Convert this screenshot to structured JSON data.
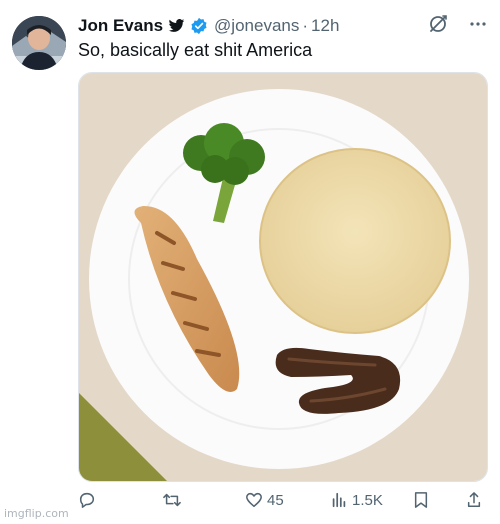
{
  "tweet": {
    "author_name": "Jon Evans",
    "handle": "@jonevans",
    "separator": "·",
    "time": "12h",
    "text": "So, basically eat shit America"
  },
  "icons": {
    "platform": "bird-icon",
    "verified": "verified-badge-icon",
    "grok": "grok-icon",
    "more": "more-icon"
  },
  "actions": {
    "reply_count": "",
    "retweet_count": "",
    "like_count": "45",
    "views_count": "1.5K"
  },
  "watermark": "imgflip.com",
  "colors": {
    "verified": "#1d9bf0",
    "secondary_text": "#536471"
  }
}
